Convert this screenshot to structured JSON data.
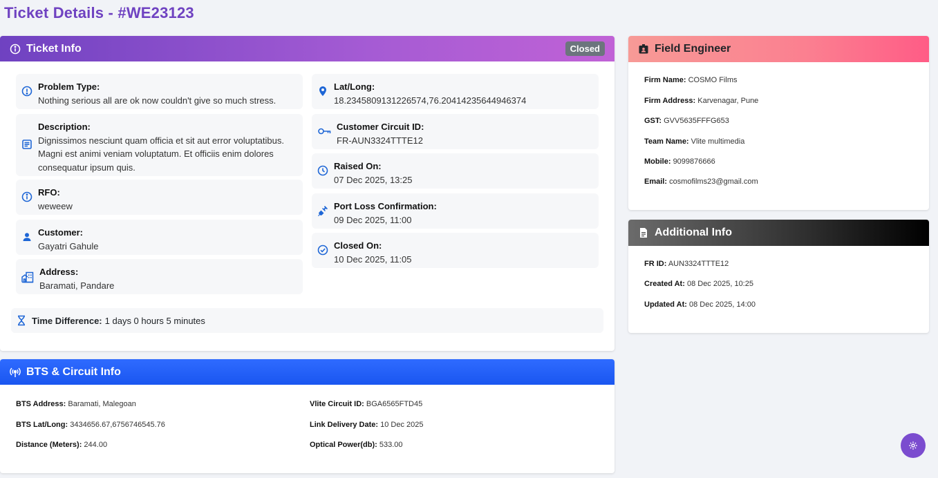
{
  "page": {
    "title": "Ticket Details - #WE23123"
  },
  "ticket_info": {
    "header": "Ticket Info",
    "status": "Closed",
    "left": [
      {
        "label": "Problem Type:",
        "value": "Nothing serious all are ok now couldn't give so much stress.",
        "icon": "alert-circle-icon"
      },
      {
        "label": "Description:",
        "value": "Dignissimos nesciunt quam officia et sit aut error voluptatibus. Magni est animi veniam voluptatum. Et officiis enim dolores consequatur ipsum quis.",
        "icon": "document-icon"
      },
      {
        "label": "RFO:",
        "value": "weweew",
        "icon": "info-icon"
      },
      {
        "label": "Customer:",
        "value": "Gayatri Gahule",
        "icon": "person-icon"
      },
      {
        "label": "Address:",
        "value": "Baramati, Pandare",
        "icon": "building-icon"
      }
    ],
    "right": [
      {
        "label": "Lat/Long:",
        "value": "18.2345809131226574,76.20414235644946374",
        "icon": "location-pin-icon"
      },
      {
        "label": "Customer Circuit ID:",
        "value": "FR-AUN3324TTTE12",
        "icon": "key-icon"
      },
      {
        "label": "Raised On:",
        "value": "07 Dec 2025, 13:25",
        "icon": "clock-icon"
      },
      {
        "label": "Port Loss Confirmation:",
        "value": "09 Dec 2025, 11:00",
        "icon": "plug-icon"
      },
      {
        "label": "Closed On:",
        "value": "10 Dec 2025, 11:05",
        "icon": "check-circle-icon"
      }
    ],
    "time_difference": {
      "label": "Time Difference:",
      "value": "1 days 0 hours 5 minutes"
    }
  },
  "bts_info": {
    "header": "BTS & Circuit Info",
    "left": [
      {
        "label": "BTS Address:",
        "value": "Baramati, Malegoan"
      },
      {
        "label": "BTS Lat/Long:",
        "value": "3434656.67,6756746545.76"
      },
      {
        "label": "Distance (Meters):",
        "value": "244.00"
      }
    ],
    "right": [
      {
        "label": "Vlite Circuit ID:",
        "value": "BGA6565FTD45"
      },
      {
        "label": "Link Delivery Date:",
        "value": "10 Dec 2025"
      },
      {
        "label": "Optical Power(db):",
        "value": "533.00"
      }
    ]
  },
  "field_engineer": {
    "header": "Field Engineer",
    "rows": [
      {
        "label": "Firm Name:",
        "value": "COSMO Films"
      },
      {
        "label": "Firm Address:",
        "value": "Karvenagar, Pune"
      },
      {
        "label": "GST:",
        "value": "GVV5635FFFG653"
      },
      {
        "label": "Team Name:",
        "value": "Vlite multimedia"
      },
      {
        "label": "Mobile:",
        "value": "9099876666"
      },
      {
        "label": "Email:",
        "value": "cosmofilms23@gmail.com"
      }
    ]
  },
  "additional_info": {
    "header": "Additional Info",
    "rows": [
      {
        "label": "FR ID:",
        "value": "AUN3324TTTE12"
      },
      {
        "label": "Created At:",
        "value": "08 Dec 2025, 10:25"
      },
      {
        "label": "Updated At:",
        "value": "08 Dec 2025, 14:00"
      }
    ]
  },
  "colors": {
    "title": "#6f42c1",
    "icon_blue": "#1e66d6",
    "fab": "#7b4ccf"
  }
}
